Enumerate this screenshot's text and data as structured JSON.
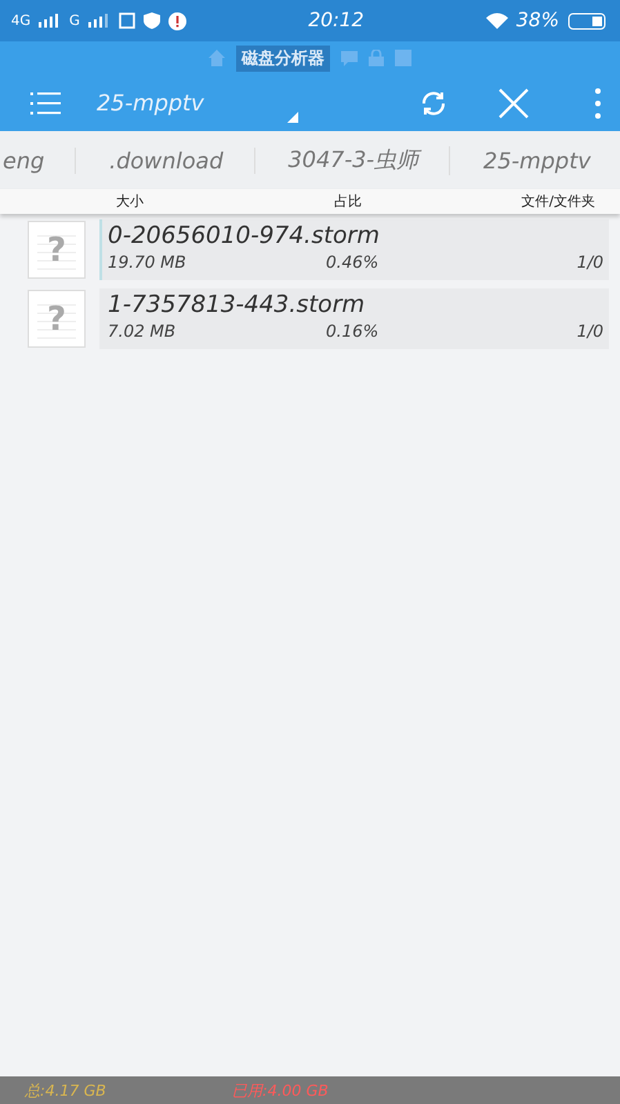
{
  "status_bar": {
    "network_1": "4G",
    "network_2": "G",
    "time": "20:12",
    "battery": "38%"
  },
  "app_title": "磁盘分析器",
  "toolbar": {
    "path": "25-mpptv"
  },
  "breadcrumbs": [
    {
      "label": "eng"
    },
    {
      "label": ".download"
    },
    {
      "label": "3047-3-虫师"
    },
    {
      "label": "25-mpptv"
    }
  ],
  "columns": [
    "大小",
    "占比",
    "文件/文件夹"
  ],
  "rows": [
    {
      "name": "0-20656010-974.storm",
      "size": "19.70 MB",
      "share": "0.46%",
      "count": "1/0",
      "selected": true,
      "icon": "?"
    },
    {
      "name": "1-7357813-443.storm",
      "size": "7.02 MB",
      "share": "0.16%",
      "count": "1/0",
      "selected": false,
      "icon": "?"
    }
  ],
  "footer": {
    "total": "总:4.17 GB",
    "used": "已用:4.00 GB"
  }
}
